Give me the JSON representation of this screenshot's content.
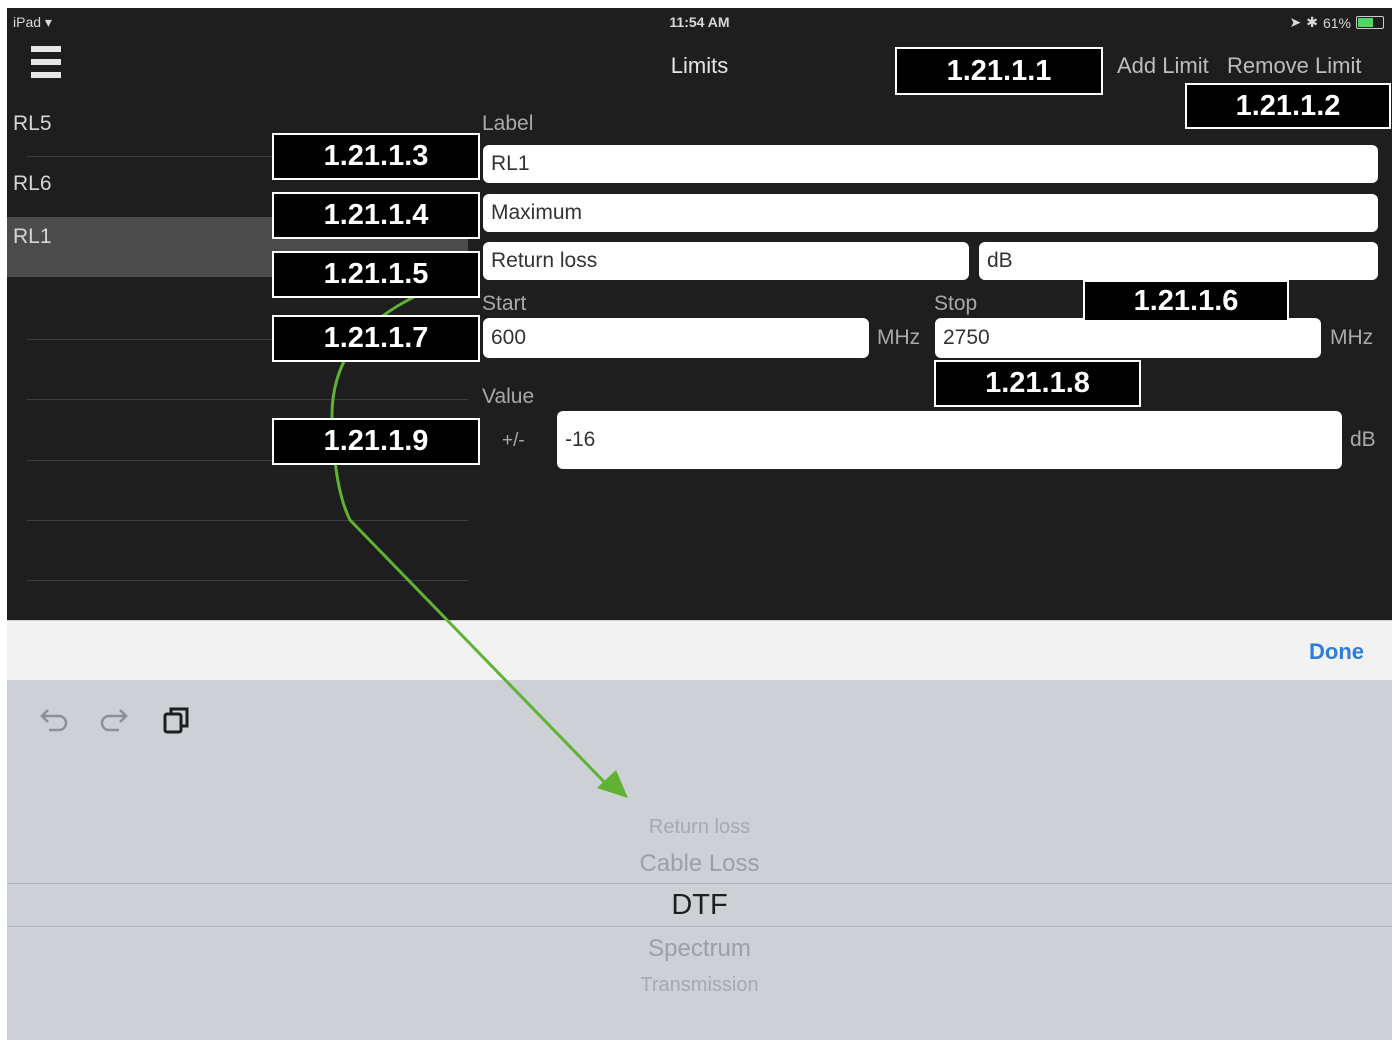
{
  "status_bar": {
    "device": "iPad",
    "time": "11:54 AM",
    "battery_percent": "61%"
  },
  "nav": {
    "title": "Limits",
    "add_limit": "Add Limit",
    "remove_limit": "Remove Limit"
  },
  "sidebar": {
    "items": [
      {
        "label": "RL5"
      },
      {
        "label": "RL6"
      },
      {
        "label": "RL1"
      }
    ]
  },
  "form": {
    "label_caption": "Label",
    "label_value": "RL1",
    "type_value": "Maximum",
    "measurement_value": "Return loss",
    "units_value": "dB",
    "start_caption": "Start",
    "start_value": "600",
    "start_unit": "MHz",
    "stop_caption": "Stop",
    "stop_value": "2750",
    "stop_unit": "MHz",
    "value_caption": "Value",
    "plus_minus": "+/-",
    "value_value": "-16",
    "value_unit": "dB"
  },
  "callouts": {
    "c1": "1.21.1.1",
    "c2": "1.21.1.2",
    "c3": "1.21.1.3",
    "c4": "1.21.1.4",
    "c5": "1.21.1.5",
    "c6": "1.21.1.6",
    "c7": "1.21.1.7",
    "c8": "1.21.1.8",
    "c9": "1.21.1.9"
  },
  "toolbar": {
    "done": "Done"
  },
  "picker": {
    "options": [
      "Return loss",
      "Cable Loss",
      "DTF",
      "Spectrum",
      "Transmission"
    ],
    "selected": "DTF"
  },
  "colors": {
    "accent": "#2f7ddb",
    "arrow": "#5fb233",
    "background": "#1e1e1e"
  }
}
